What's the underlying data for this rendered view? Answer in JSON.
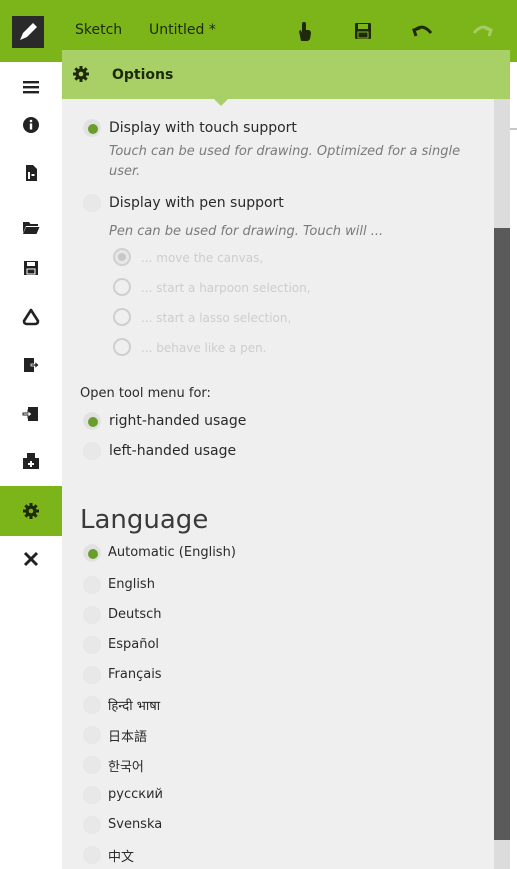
{
  "app": {
    "name": "Sketch",
    "document_title": "Untitled *"
  },
  "toolbar": {
    "icons": [
      "hand-icon",
      "save-icon",
      "undo-icon",
      "redo-icon"
    ],
    "redo_enabled": false
  },
  "sidebar": {
    "items": [
      {
        "icon": "menu-icon",
        "active": false
      },
      {
        "icon": "info-icon",
        "active": false
      },
      {
        "icon": "new-document-icon",
        "active": false
      },
      {
        "icon": "open-folder-icon",
        "active": false
      },
      {
        "icon": "save-icon",
        "active": false
      },
      {
        "icon": "shapes-icon",
        "active": false
      },
      {
        "icon": "export-icon",
        "active": false
      },
      {
        "icon": "import-icon",
        "active": false
      },
      {
        "icon": "print-icon",
        "active": false
      },
      {
        "icon": "gear-icon",
        "active": true
      },
      {
        "icon": "close-icon",
        "active": false
      }
    ]
  },
  "options": {
    "title": "Options",
    "display": {
      "touch_label": "Display with touch support",
      "touch_selected": true,
      "touch_description": "Touch can be used for drawing. Optimized for a single user.",
      "pen_label": "Display with pen support",
      "pen_selected": false,
      "pen_description": "Pen can be used for drawing. Touch will ...",
      "pen_touch_options": [
        {
          "label": "... move the canvas,",
          "selected": true
        },
        {
          "label": "... start a harpoon selection,",
          "selected": false
        },
        {
          "label": "... start a lasso selection,",
          "selected": false
        },
        {
          "label": "... behave like a pen.",
          "selected": false
        }
      ]
    },
    "tool_menu": {
      "heading": "Open tool menu for:",
      "right_label": "right-handed usage",
      "right_selected": true,
      "left_label": "left-handed usage",
      "left_selected": false
    },
    "language": {
      "heading": "Language",
      "selected": "Automatic (English)",
      "options": [
        "Automatic (English)",
        "English",
        "Deutsch",
        "Español",
        "Français",
        "हिन्दी भाषा",
        "日本語",
        "한국어",
        "русский",
        "Svenska",
        "中文"
      ]
    }
  },
  "colors": {
    "accent": "#7cb51a",
    "header_green": "#a8d066",
    "panel_bg": "#efeff0",
    "radio_dot": "#6a9e2a"
  }
}
